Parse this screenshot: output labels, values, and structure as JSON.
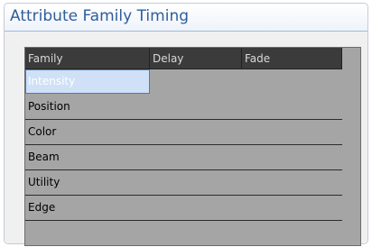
{
  "panel": {
    "title": "Attribute Family Timing"
  },
  "grid": {
    "columns": [
      "Family",
      "Delay",
      "Fade"
    ],
    "rows": [
      {
        "family": "Intensity",
        "delay": "",
        "fade": "",
        "selected": true
      },
      {
        "family": "Position",
        "delay": "",
        "fade": "",
        "selected": false
      },
      {
        "family": "Color",
        "delay": "",
        "fade": "",
        "selected": false
      },
      {
        "family": "Beam",
        "delay": "",
        "fade": "",
        "selected": false
      },
      {
        "family": "Utility",
        "delay": "",
        "fade": "",
        "selected": false
      },
      {
        "family": "Edge",
        "delay": "",
        "fade": "",
        "selected": false
      }
    ]
  }
}
